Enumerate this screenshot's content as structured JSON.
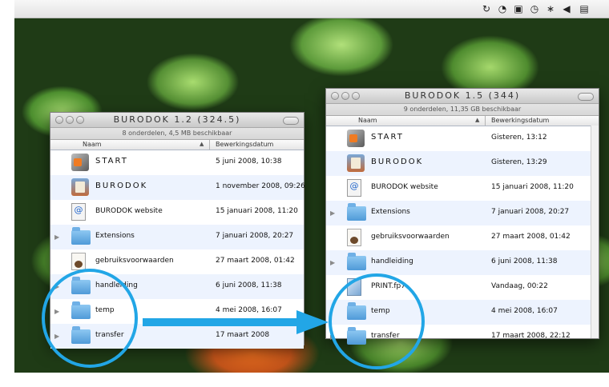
{
  "menubar": {
    "icons": [
      "sync-icon",
      "wifi-icon",
      "display-icon",
      "time-machine-icon",
      "bluetooth-icon",
      "volume-icon",
      "input-menu-icon"
    ]
  },
  "window_left": {
    "title": "BURODOK 1.2 (324.5)",
    "status": "8 onderdelen, 4,5 MB beschikbaar",
    "col_name": "Naam",
    "col_date": "Bewerkingsdatum",
    "rows": [
      {
        "name": "START",
        "date": "5 juni 2008, 10:38",
        "icon": "app-icon"
      },
      {
        "name": "BURODOK",
        "date": "1 november 2008, 09:26",
        "icon": "burodok-app-icon"
      },
      {
        "name": "BURODOK website",
        "date": "15 januari 2008, 11:20",
        "icon": "weblink-icon"
      },
      {
        "name": "Extensions",
        "date": "7 januari 2008, 20:27",
        "icon": "folder-icon"
      },
      {
        "name": "gebruiksvoorwaarden",
        "date": "27 maart 2008, 01:42",
        "icon": "document-icon"
      },
      {
        "name": "handleiding",
        "date": "6 juni 2008, 11:38",
        "icon": "folder-icon"
      },
      {
        "name": "temp",
        "date": "4 mei 2008, 16:07",
        "icon": "folder-icon"
      },
      {
        "name": "transfer",
        "date": "17 maart 2008",
        "icon": "folder-icon"
      }
    ]
  },
  "window_right": {
    "title": "BURODOK 1.5 (344)",
    "status": "9 onderdelen, 11,35 GB beschikbaar",
    "col_name": "Naam",
    "col_date": "Bewerkingsdatum",
    "rows": [
      {
        "name": "START",
        "date": "Gisteren, 13:12",
        "icon": "app-icon"
      },
      {
        "name": "BURODOK",
        "date": "Gisteren, 13:29",
        "icon": "burodok-app-icon"
      },
      {
        "name": "BURODOK website",
        "date": "15 januari 2008, 11:20",
        "icon": "weblink-icon"
      },
      {
        "name": "Extensions",
        "date": "7 januari 2008, 20:27",
        "icon": "folder-icon"
      },
      {
        "name": "gebruiksvoorwaarden",
        "date": "27 maart 2008, 01:42",
        "icon": "document-icon"
      },
      {
        "name": "handleiding",
        "date": "6 juni 2008, 11:38",
        "icon": "folder-icon"
      },
      {
        "name": "PRINT.fp7",
        "date": "Vandaag, 00:22",
        "icon": "filemaker-file-icon"
      },
      {
        "name": "temp",
        "date": "4 mei 2008, 16:07",
        "icon": "folder-icon"
      },
      {
        "name": "transfer",
        "date": "17 maart 2008, 22:12",
        "icon": "folder-icon"
      }
    ]
  },
  "annotation": {
    "accent_color": "#22a6e6"
  }
}
